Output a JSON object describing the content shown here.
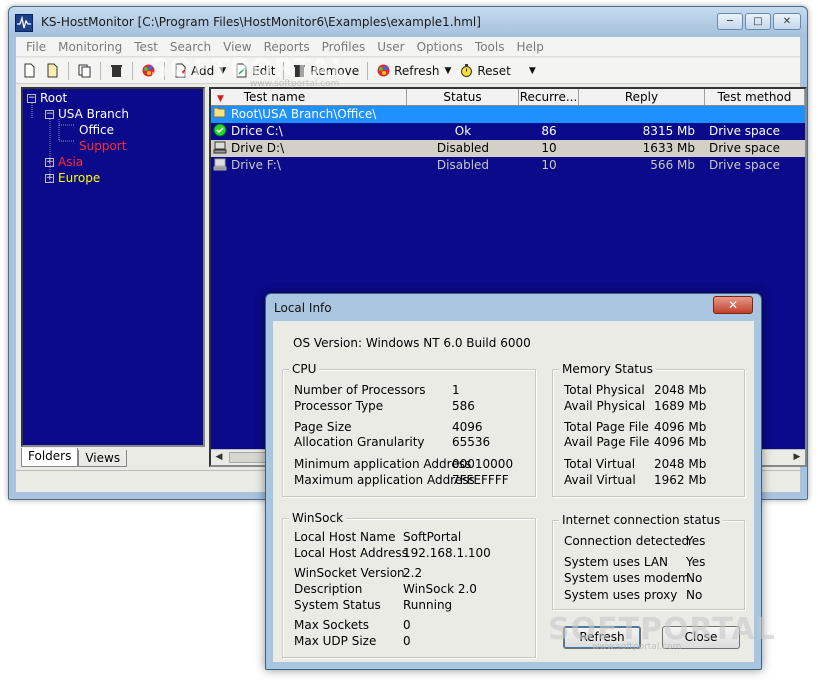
{
  "main": {
    "title": "KS-HostMonitor  [C:\\Program Files\\HostMonitor6\\Examples\\example1.hml]",
    "menu": [
      "File",
      "Monitoring",
      "Test",
      "Search",
      "View",
      "Reports",
      "Profiles",
      "User",
      "Options",
      "Tools",
      "Help"
    ],
    "toolbar": {
      "add": "Add",
      "edit": "Edit",
      "remove": "Remove",
      "refresh": "Refresh",
      "reset": "Reset"
    },
    "tree": {
      "root": "Root",
      "usa_branch": "USA Branch",
      "office": "Office",
      "support": "Support",
      "asia": "Asia",
      "europe": "Europe"
    },
    "tabs": [
      "Folders",
      "Views"
    ],
    "list": {
      "columns": [
        "Test name",
        "Status",
        "Recurre...",
        "Reply",
        "Test method"
      ],
      "folder_row": "Root\\USA Branch\\Office\\",
      "rows": [
        {
          "name": "Drice C:\\",
          "status": "Ok",
          "recurrence": "86",
          "reply": "8315 Mb",
          "method": "Drive space"
        },
        {
          "name": "Drive D:\\",
          "status": "Disabled",
          "recurrence": "10",
          "reply": "1633 Mb",
          "method": "Drive space"
        },
        {
          "name": "Drive F:\\",
          "status": "Disabled",
          "recurrence": "10",
          "reply": "566 Mb",
          "method": "Drive space"
        }
      ]
    }
  },
  "dialog": {
    "title": "Local Info",
    "os_version": "OS Version: Windows NT 6.0  Build 6000",
    "cpu": {
      "title": "CPU",
      "rows": [
        {
          "label": "Number of Processors",
          "value": "1"
        },
        {
          "label": "Processor Type",
          "value": "586"
        },
        {
          "label": "Page Size",
          "value": "4096"
        },
        {
          "label": "Allocation Granularity",
          "value": "65536"
        },
        {
          "label": "Minimum application Address",
          "value": "00010000"
        },
        {
          "label": "Maximum application Address",
          "value": "7FFEFFFF"
        }
      ]
    },
    "memory": {
      "title": "Memory Status",
      "rows": [
        {
          "label": "Total Physical",
          "value": "2048 Mb"
        },
        {
          "label": "Avail Physical",
          "value": "1689 Mb"
        },
        {
          "label": "Total Page File",
          "value": "4096 Mb"
        },
        {
          "label": "Avail Page File",
          "value": "4096 Mb"
        },
        {
          "label": "Total Virtual",
          "value": "2048 Mb"
        },
        {
          "label": "Avail Virtual",
          "value": "1962 Mb"
        }
      ]
    },
    "winsock": {
      "title": "WinSock",
      "rows": [
        {
          "label": "Local Host Name",
          "value": "SoftPortal"
        },
        {
          "label": "Local Host Address",
          "value": "192.168.1.100"
        },
        {
          "label": "WinSocket Version",
          "value": "2.2"
        },
        {
          "label": "Description",
          "value": "WinSock 2.0"
        },
        {
          "label": "System Status",
          "value": "Running"
        },
        {
          "label": "Max Sockets",
          "value": "0"
        },
        {
          "label": "Max UDP Size",
          "value": "0"
        }
      ]
    },
    "internet": {
      "title": "Internet connection status",
      "rows": [
        {
          "label": "Connection detected",
          "value": "Yes"
        },
        {
          "label": "System uses LAN",
          "value": "Yes"
        },
        {
          "label": "System uses modem",
          "value": "No"
        },
        {
          "label": "System uses proxy",
          "value": "No"
        }
      ]
    },
    "buttons": {
      "refresh": "Refresh",
      "close": "Close"
    }
  },
  "watermark": {
    "text": "SOFTPORTAL",
    "url": "www.softportal.com"
  },
  "colors": {
    "tree_bg": "#0a0a8a",
    "selection": "#1e90ff",
    "disabled_row": "#d4d0c8",
    "red_text": "#ff2a2a",
    "yellow_text": "#ffff00"
  }
}
